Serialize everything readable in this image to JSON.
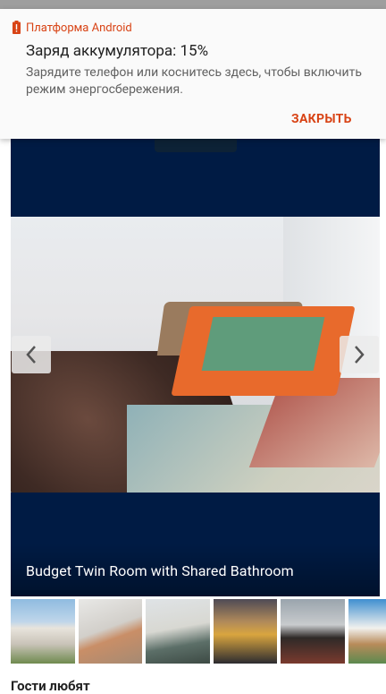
{
  "notification": {
    "app_name": "Платформа Android",
    "title": "Заряд аккумулятора: 15%",
    "body": "Зарядите телефон или коснитесь здесь, чтобы включить режим энергосбережения.",
    "action_label": "ЗАКРЫТЬ",
    "accent_color": "#d84315",
    "icon": "battery-alert-icon"
  },
  "gallery": {
    "caption": "Budget Twin Room with Shared Bathroom",
    "prev_icon": "chevron-left-icon",
    "next_icon": "chevron-right-icon",
    "background_color": "#001b44"
  },
  "thumbnails": [
    {
      "name": "exterior"
    },
    {
      "name": "room-bed"
    },
    {
      "name": "room-sofa"
    },
    {
      "name": "bridge-night"
    },
    {
      "name": "steam-locomotive"
    },
    {
      "name": "waterfront"
    }
  ],
  "section": {
    "title": "Гости любят"
  }
}
